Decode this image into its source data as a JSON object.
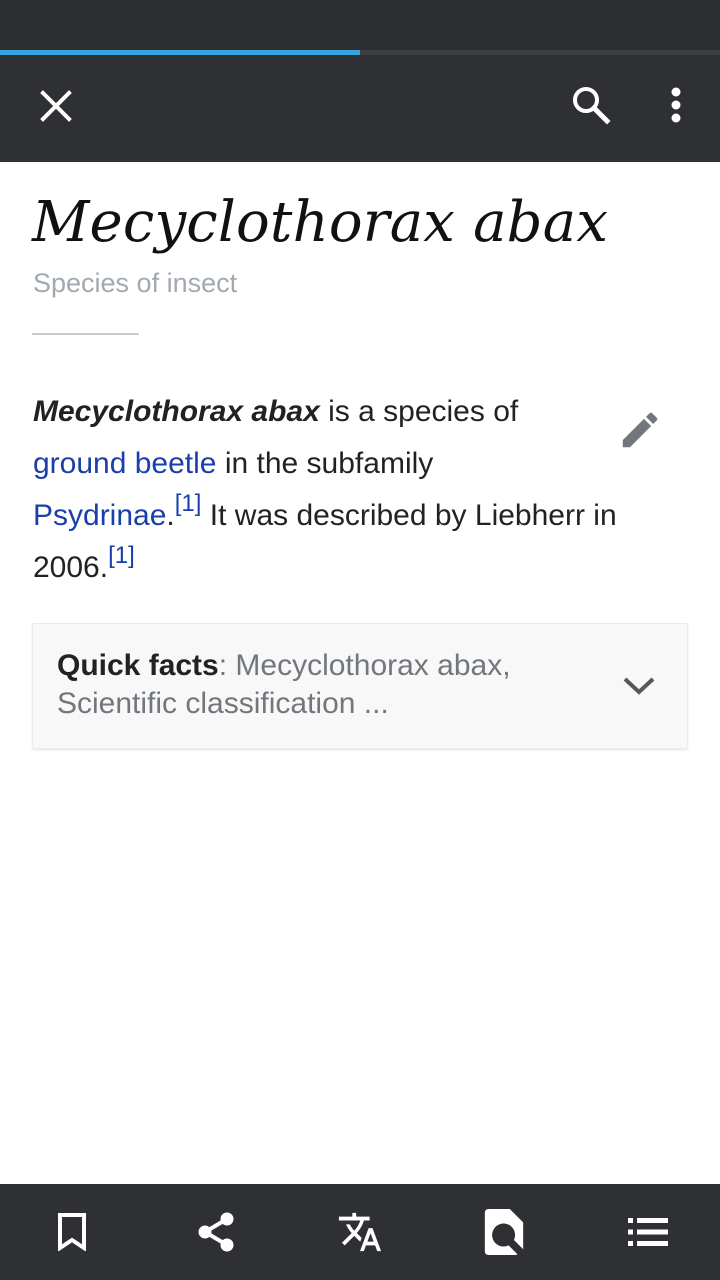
{
  "page_load_progress": 0.5,
  "toolbar": {
    "close_icon": "close-icon",
    "search_icon": "search-icon",
    "overflow_icon": "more-vert-icon"
  },
  "article": {
    "title": "Mecyclothorax abax",
    "description": "Species of insect",
    "edit_icon": "pencil-icon",
    "intro": {
      "subject": "Mecyclothorax abax",
      "text1": " is a species of ",
      "link1": "ground beetle",
      "text2": " in the subfamily ",
      "link2": "Psydrinae",
      "text3": ".",
      "ref1": "[1]",
      "text4": " It was described by Liebherr in 2006.",
      "ref2": "[1]"
    }
  },
  "quick_facts": {
    "label": "Quick facts",
    "separator": ": ",
    "summary": "Mecyclothorax abax, Scientific classification ...",
    "expand_icon": "chevron-down-icon"
  },
  "bottom_bar": {
    "items": [
      "bookmark-icon",
      "share-icon",
      "translate-icon",
      "find-in-page-icon",
      "table-of-contents-icon"
    ]
  },
  "colors": {
    "toolbar_bg": "#2f3033",
    "progress_accent": "#36a4de",
    "link": "#1a3faa",
    "muted_text": "#a2a9b1"
  }
}
